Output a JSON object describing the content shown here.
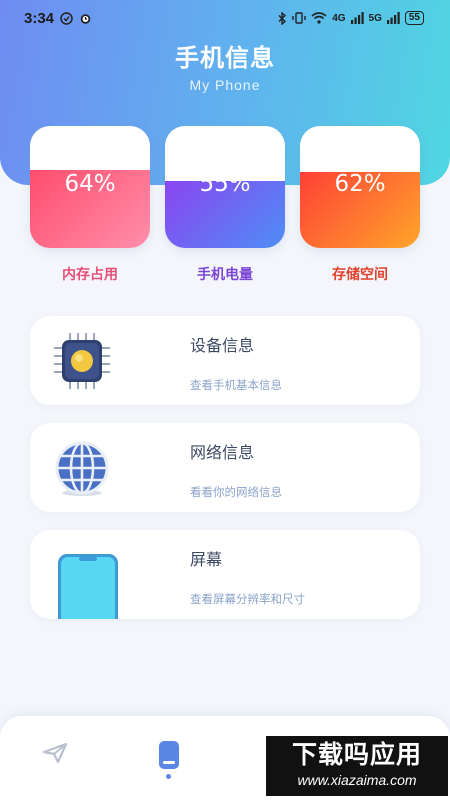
{
  "status_bar": {
    "time": "3:34",
    "network_label_1": "4G",
    "network_label_2": "5G",
    "battery": "55"
  },
  "header": {
    "title": "手机信息",
    "subtitle": "My Phone"
  },
  "gauges": [
    {
      "value": "64%",
      "label": "内存占用",
      "level": 0.64,
      "gradient": [
        "#ff4d6d",
        "#ff8fab"
      ],
      "label_color": "#e94e77"
    },
    {
      "value": "55%",
      "label": "手机电量",
      "level": 0.55,
      "gradient": [
        "#8b45f0",
        "#4e8ef5"
      ],
      "label_color": "#7a45d8"
    },
    {
      "value": "62%",
      "label": "存储空间",
      "level": 0.62,
      "gradient": [
        "#ff3f36",
        "#ffa62b"
      ],
      "label_color": "#e2422d"
    }
  ],
  "cards": [
    {
      "title": "设备信息",
      "subtitle": "查看手机基本信息",
      "icon": "chip-icon"
    },
    {
      "title": "网络信息",
      "subtitle": "看看你的网络信息",
      "icon": "globe-icon"
    },
    {
      "title": "屏幕",
      "subtitle": "查看屏幕分辨率和尺寸",
      "icon": "phone-screen-icon"
    }
  ],
  "bottom_nav": {
    "items": [
      "send-icon",
      "phone-icon"
    ],
    "active_color": "#5b86e5"
  },
  "watermark": {
    "line1": "下载吗应用",
    "line2": "www.xiazaima.com"
  }
}
